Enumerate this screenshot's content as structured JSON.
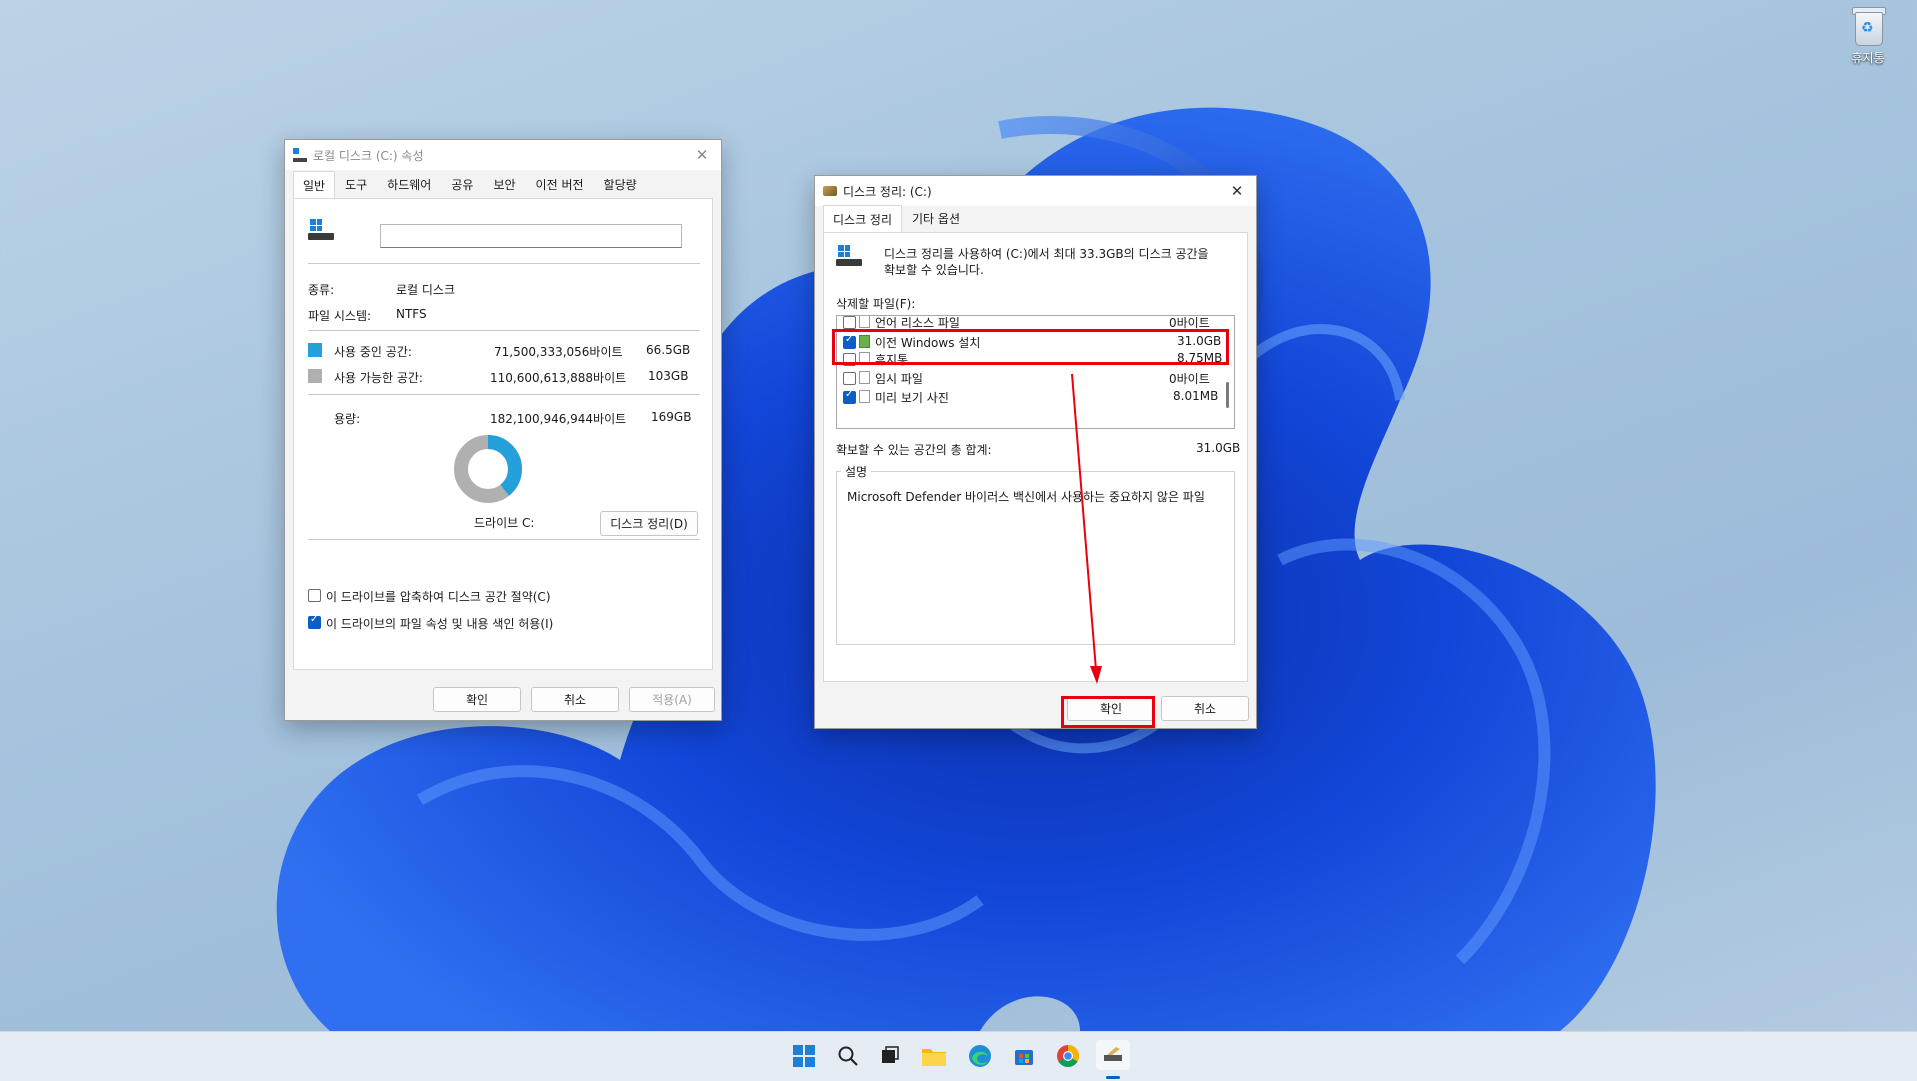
{
  "desktop": {
    "recycle_bin_label": "휴지통"
  },
  "props_window": {
    "title": "로컬 디스크 (C:) 속성",
    "tabs": [
      "일반",
      "도구",
      "하드웨어",
      "공유",
      "보안",
      "이전 버전",
      "할당량"
    ],
    "active_tab": "일반",
    "name_field_value": "",
    "type_label": "종류:",
    "type_value": "로컬 디스크",
    "fs_label": "파일 시스템:",
    "fs_value": "NTFS",
    "used_label": "사용 중인 공간:",
    "used_bytes": "71,500,333,056바이트",
    "used_size": "66.5GB",
    "free_label": "사용 가능한 공간:",
    "free_bytes": "110,600,613,888바이트",
    "free_size": "103GB",
    "capacity_label": "용량:",
    "capacity_bytes": "182,100,946,944바이트",
    "capacity_size": "169GB",
    "drive_label": "드라이브 C:",
    "cleanup_button": "디스크 정리(D)",
    "compress_label": "이 드라이브를 압축하여 디스크 공간 절약(C)",
    "compress_checked": false,
    "index_label": "이 드라이브의 파일 속성 및 내용 색인 허용(I)",
    "index_checked": true,
    "ok": "확인",
    "cancel": "취소",
    "apply": "적용(A)",
    "colors": {
      "used": "#26a0da",
      "free": "#b0b0b0"
    },
    "used_fraction": 0.393
  },
  "cleanup_window": {
    "title": "디스크 정리: (C:)",
    "tabs": [
      "디스크 정리",
      "기타 옵션"
    ],
    "active_tab": "디스크 정리",
    "intro_line1": "디스크 정리를 사용하여 (C:)에서 최대 33.3GB의 디스크 공간을",
    "intro_line2": "확보할 수 있습니다.",
    "files_label": "삭제할 파일(F):",
    "files": [
      {
        "name": "언어 리소스 파일",
        "size": "0바이트",
        "checked": false
      },
      {
        "name": "이전 Windows 설치",
        "size": "31.0GB",
        "checked": true
      },
      {
        "name": "휴지통",
        "size": "8.75MB",
        "checked": false
      },
      {
        "name": "임시 파일",
        "size": "0바이트",
        "checked": false
      },
      {
        "name": "미리 보기 사진",
        "size": "8.01MB",
        "checked": true
      }
    ],
    "total_label": "확보할 수 있는 공간의 총 합계:",
    "total_value": "31.0GB",
    "desc_legend": "설명",
    "desc_text": "Microsoft Defender 바이러스 백신에서 사용하는 중요하지 않은 파일",
    "ok": "확인",
    "cancel": "취소"
  },
  "annotation": {
    "color": "#e8000f"
  },
  "taskbar": {
    "icons": [
      "start-icon",
      "search-icon",
      "task-view-icon",
      "file-explorer-icon",
      "edge-icon",
      "store-icon",
      "chrome-icon",
      "disk-cleanup-icon"
    ]
  }
}
